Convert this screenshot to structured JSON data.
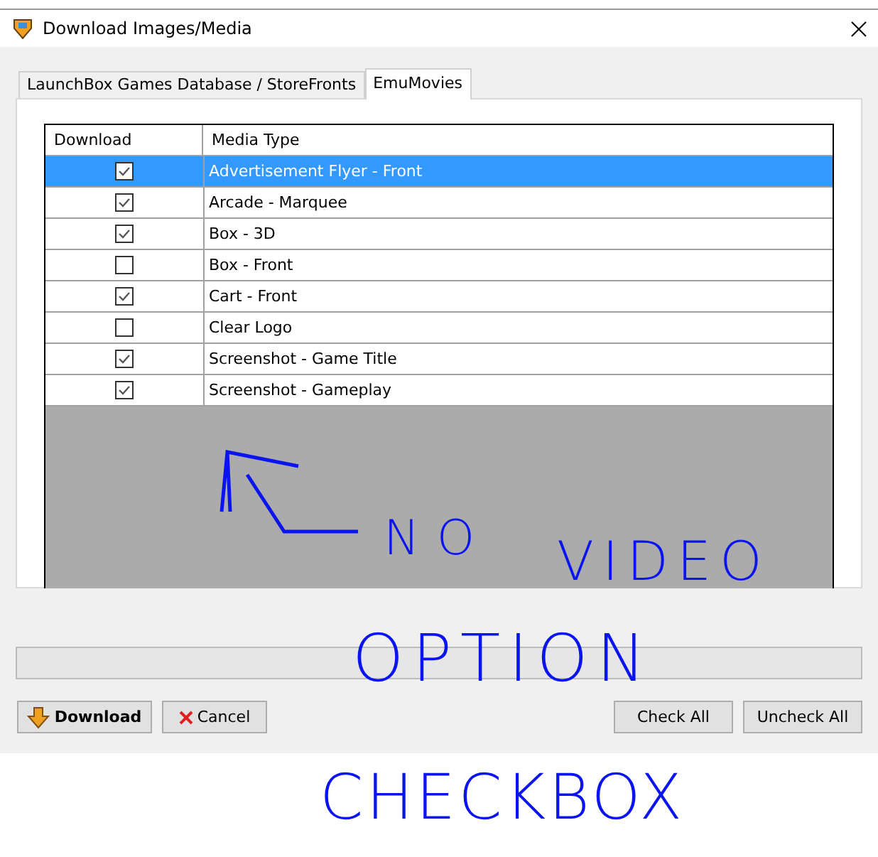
{
  "window": {
    "title": "Download Images/Media"
  },
  "tabs": [
    {
      "label": "LaunchBox Games Database / StoreFronts",
      "selected": false
    },
    {
      "label": "EmuMovies",
      "selected": true
    }
  ],
  "table": {
    "columns": [
      "Download",
      "Media Type"
    ],
    "rows": [
      {
        "checked": true,
        "media_type": "Advertisement Flyer - Front",
        "selected": true
      },
      {
        "checked": true,
        "media_type": "Arcade - Marquee",
        "selected": false
      },
      {
        "checked": true,
        "media_type": "Box - 3D",
        "selected": false
      },
      {
        "checked": false,
        "media_type": "Box - Front",
        "selected": false
      },
      {
        "checked": true,
        "media_type": "Cart - Front",
        "selected": false
      },
      {
        "checked": false,
        "media_type": "Clear Logo",
        "selected": false
      },
      {
        "checked": true,
        "media_type": "Screenshot - Game Title",
        "selected": false
      },
      {
        "checked": true,
        "media_type": "Screenshot - Gameplay",
        "selected": false
      }
    ]
  },
  "progress": {
    "level": 0
  },
  "buttons": [
    {
      "kind": "download",
      "label": "Download"
    },
    {
      "kind": "cancel",
      "label": "Cancel"
    },
    {
      "kind": "plain",
      "label": "Check All"
    },
    {
      "kind": "plain",
      "label": "Uncheck All"
    }
  ],
  "annotation": {
    "words": [
      "NO",
      "VIDEO",
      "OPTION",
      "CHECKBOX"
    ],
    "color": "#0a14f0"
  }
}
